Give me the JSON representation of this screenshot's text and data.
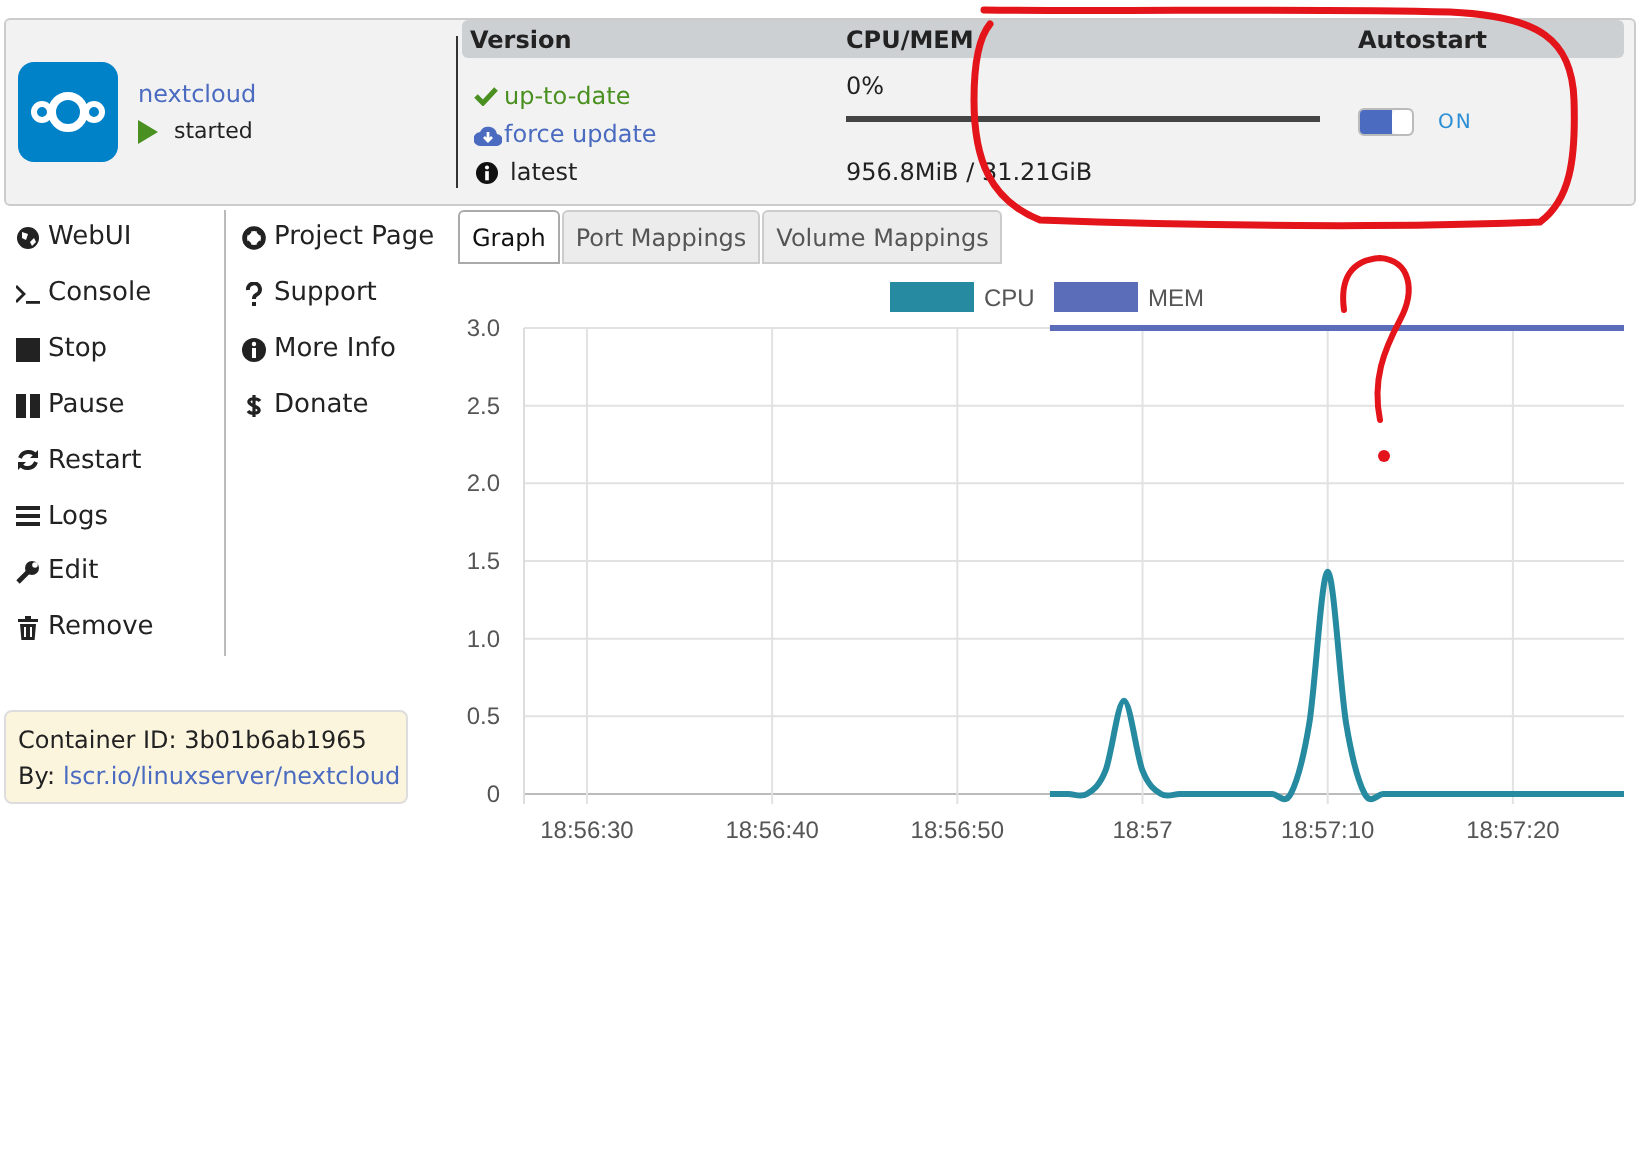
{
  "container": {
    "name": "nextcloud",
    "status": "started"
  },
  "info_table": {
    "columns": [
      "Version",
      "CPU/MEM",
      "Autostart"
    ],
    "version": {
      "update_status": "up-to-date",
      "force_update": "force update",
      "tag": "latest"
    },
    "cpu_mem": {
      "cpu": "0%",
      "memory": "956.8MiB / 31.21GiB"
    },
    "autostart": {
      "on": true,
      "label": "ON"
    }
  },
  "actions": [
    "WebUI",
    "Console",
    "Stop",
    "Pause",
    "Restart",
    "Logs",
    "Edit",
    "Remove"
  ],
  "links": [
    "Project Page",
    "Support",
    "More Info",
    "Donate"
  ],
  "container_info": {
    "id": "Container ID: 3b01b6ab1965",
    "by_label": "By:",
    "by_link": "lscr.io/linuxserver/nextcloud"
  },
  "tabs": [
    {
      "label": "Graph",
      "selected": true
    },
    {
      "label": "Port Mappings",
      "selected": false
    },
    {
      "label": "Volume Mappings",
      "selected": false
    }
  ],
  "chart_data": {
    "type": "line",
    "categories": [
      null,
      null,
      null,
      "18:56:30",
      null,
      null,
      null,
      null,
      null,
      null,
      null,
      null,
      null,
      "18:56:40",
      null,
      null,
      null,
      null,
      null,
      null,
      null,
      null,
      null,
      "18:56:50",
      null,
      null,
      null,
      null,
      null,
      null,
      null,
      null,
      null,
      "18:57",
      null,
      null,
      null,
      null,
      null,
      null,
      null,
      null,
      null,
      "18:57:10",
      null,
      null,
      null,
      null,
      null,
      null,
      null,
      null,
      null,
      "18:57:20",
      null,
      null,
      null,
      null,
      null,
      null
    ],
    "series": [
      {
        "name": "CPU",
        "color": "#268ba0",
        "values": [
          null,
          null,
          null,
          null,
          null,
          null,
          null,
          null,
          null,
          null,
          null,
          null,
          null,
          null,
          null,
          null,
          null,
          null,
          null,
          null,
          null,
          null,
          null,
          null,
          null,
          null,
          null,
          null,
          0,
          0,
          0,
          0.15,
          0.6,
          0.15,
          0,
          0,
          0,
          0,
          0,
          0,
          0,
          0,
          0.45,
          1.43,
          0.45,
          0,
          0,
          0,
          0,
          0,
          0,
          0,
          0,
          0,
          0,
          0,
          0,
          0,
          0,
          0
        ]
      },
      {
        "name": "MEM",
        "color": "#5b6cb8",
        "values": [
          null,
          null,
          null,
          null,
          null,
          null,
          null,
          null,
          null,
          null,
          null,
          null,
          null,
          null,
          null,
          null,
          null,
          null,
          null,
          null,
          null,
          null,
          null,
          null,
          null,
          null,
          null,
          null,
          3,
          3,
          3,
          3,
          3,
          3,
          3,
          3,
          3,
          3,
          3,
          3,
          3,
          3,
          3,
          3,
          3,
          3,
          3,
          3,
          3,
          3,
          3,
          3,
          3,
          3,
          3,
          3,
          3,
          3,
          3,
          3
        ]
      }
    ],
    "ylim": [
      0,
      3
    ],
    "grid": true,
    "legend": "top",
    "yticks": [
      {
        "value": 0,
        "label": "0"
      },
      {
        "value": 0.5,
        "label": "0.5"
      },
      {
        "value": 1,
        "label": "1.0"
      },
      {
        "value": 1.5,
        "label": "1.5"
      },
      {
        "value": 2,
        "label": "2.0"
      },
      {
        "value": 2.5,
        "label": "2.5"
      },
      {
        "value": 3,
        "label": "3.0"
      }
    ]
  }
}
